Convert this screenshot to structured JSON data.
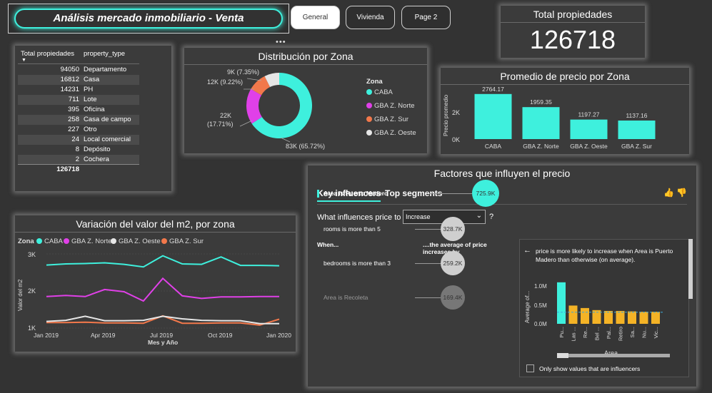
{
  "header": {
    "title": "Análisis mercado inmobiliario - Venta",
    "tabs": [
      {
        "label": "General",
        "active": true
      },
      {
        "label": "Vivienda",
        "active": false
      },
      {
        "label": "Page 2",
        "active": false
      }
    ]
  },
  "kpi": {
    "title": "Total propiedades",
    "value": "126718"
  },
  "type_table": {
    "headers": [
      "Total propiedades",
      "property_type"
    ],
    "rows": [
      {
        "count": "94050",
        "type": "Departamento"
      },
      {
        "count": "16812",
        "type": "Casa"
      },
      {
        "count": "14231",
        "type": "PH"
      },
      {
        "count": "711",
        "type": "Lote"
      },
      {
        "count": "395",
        "type": "Oficina"
      },
      {
        "count": "258",
        "type": "Casa de campo"
      },
      {
        "count": "227",
        "type": "Otro"
      },
      {
        "count": "24",
        "type": "Local comercial"
      },
      {
        "count": "8",
        "type": "Depósito"
      },
      {
        "count": "2",
        "type": "Cochera"
      }
    ],
    "total": "126718"
  },
  "donut": {
    "title": "Distribución por Zona",
    "legend_title": "Zona",
    "labels": [
      "83K (65.72%)",
      "22K",
      "(17.71%)",
      "12K (9.22%)",
      "9K (7.35%)"
    ],
    "chart_data": {
      "type": "pie",
      "categories": [
        "CABA",
        "GBA Z. Norte",
        "GBA Z. Sur",
        "GBA Z. Oeste"
      ],
      "values": [
        65.72,
        17.71,
        9.22,
        7.35
      ],
      "colors": [
        "#3ef0dd",
        "#e040e8",
        "#f2784b",
        "#e6e6e6"
      ]
    }
  },
  "bar": {
    "title": "Promedio de precio por Zona",
    "ylabel": "Precio promedio",
    "ticks": [
      "2K",
      "0K"
    ],
    "value_labels": [
      "2764.17",
      "1959.35",
      "1197.27",
      "1137.16"
    ],
    "chart_data": {
      "type": "bar",
      "categories": [
        "CABA",
        "GBA Z. Norte",
        "GBA Z. Oeste",
        "GBA Z. Sur"
      ],
      "values": [
        2764.17,
        1959.35,
        1197.27,
        1137.16
      ],
      "ylim": [
        0,
        3000
      ],
      "color": "#3ef0dd"
    }
  },
  "line": {
    "title": "Variación del valor del m2, por zona",
    "legend_title": "Zona",
    "ylabel": "Valor del m2",
    "xlabel": "Mes y Año",
    "yticks": [
      "3K",
      "2K",
      "1K"
    ],
    "xticks": [
      "Jan 2019",
      "Apr 2019",
      "Jul 2019",
      "Oct 2019",
      "Jan 2020"
    ],
    "chart_data": {
      "type": "line",
      "x": [
        "Jan 2019",
        "Feb 2019",
        "Mar 2019",
        "Apr 2019",
        "May 2019",
        "Jun 2019",
        "Jul 2019",
        "Aug 2019",
        "Sep 2019",
        "Oct 2019",
        "Nov 2019",
        "Dec 2019",
        "Jan 2020"
      ],
      "ylim": [
        1000,
        3000
      ],
      "series": [
        {
          "name": "CABA",
          "color": "#3ef0dd",
          "values": [
            2700,
            2730,
            2740,
            2760,
            2720,
            2650,
            2950,
            2730,
            2720,
            2920,
            2690,
            2690,
            2680
          ]
        },
        {
          "name": "GBA Z. Norte",
          "color": "#e040e8",
          "values": [
            1850,
            1880,
            1850,
            2040,
            1980,
            1730,
            2340,
            1870,
            1800,
            1840,
            1840,
            1850,
            1850
          ]
        },
        {
          "name": "GBA Z. Oeste",
          "color": "#e6e6e6",
          "values": [
            1180,
            1210,
            1320,
            1200,
            1200,
            1210,
            1320,
            1250,
            1210,
            1200,
            1200,
            1120,
            1120
          ]
        },
        {
          "name": "GBA Z. Sur",
          "color": "#f2784b",
          "values": [
            1150,
            1150,
            1160,
            1140,
            1140,
            1130,
            1330,
            1130,
            1130,
            1140,
            1140,
            1080,
            1240
          ]
        }
      ]
    }
  },
  "influencers": {
    "title": "Factores que influyen el precio",
    "tab_key": "Key influencers",
    "tab_top": "Top segments",
    "question": "What influences price to",
    "dropdown_value": "Increase",
    "help": "?",
    "col_when": "When...",
    "col_avg": "....the average of price increases by",
    "items": [
      {
        "label": "Area is Puerto Madero",
        "value": "725.9K"
      },
      {
        "label": "rooms is more than 5",
        "value": "328.7K"
      },
      {
        "label": "bedrooms is more than 3",
        "value": "259.2K"
      },
      {
        "label": "Area is Recoleta",
        "value": "169.4K"
      }
    ],
    "detail_text": "price is more likely to increase when Area is Puerto Madero than otherwise (on average).",
    "detail_chart": {
      "ylabel": "Average of...",
      "xlabel": "Area",
      "yticks": [
        "1.0M",
        "0.5M",
        "0.0M"
      ],
      "chart_data": {
        "type": "bar",
        "categories": [
          "Pu...",
          "Las ...",
          "Re...",
          "Bel ...",
          "Pal...",
          "Retiro",
          "Sa...",
          "Nu...",
          "Vic..."
        ],
        "values": [
          1000000,
          440000,
          380000,
          330000,
          310000,
          310000,
          300000,
          290000,
          290000
        ],
        "ylim": [
          0,
          1100000
        ],
        "highlight_color": "#3ef0dd",
        "color": "#f4b326",
        "average_line": 280000
      }
    },
    "checkbox_label": "Only show values that are influencers"
  }
}
